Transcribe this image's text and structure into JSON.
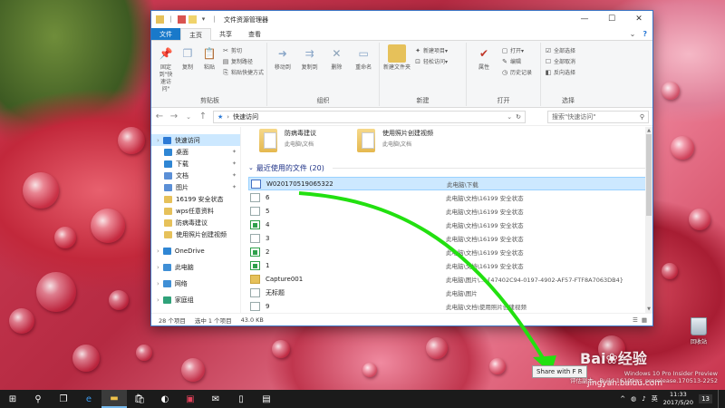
{
  "window": {
    "title": "文件资源管理器",
    "tabs": [
      "文件",
      "主页",
      "共享",
      "查看"
    ],
    "active_tab": "主页"
  },
  "ribbon": {
    "groups": [
      {
        "label": "剪贴板",
        "buttons": [
          "固定到\"快速访问\"",
          "复制",
          "粘贴"
        ],
        "small": [
          "剪切",
          "复制路径",
          "粘贴快捷方式"
        ]
      },
      {
        "label": "组织",
        "buttons": [
          "移动到",
          "复制到",
          "删除",
          "重命名"
        ]
      },
      {
        "label": "新建",
        "buttons": [
          "新建文件夹"
        ],
        "small": [
          "新建项目▾",
          "轻松访问▾"
        ]
      },
      {
        "label": "打开",
        "buttons": [
          "属性"
        ],
        "small": [
          "打开▾",
          "编辑",
          "历史记录"
        ]
      },
      {
        "label": "选择",
        "small": [
          "全部选择",
          "全部取消",
          "反向选择"
        ]
      }
    ]
  },
  "address": {
    "star": "★",
    "location": "快速访问",
    "search_placeholder": "搜索\"快速访问\""
  },
  "nav": {
    "items": [
      {
        "label": "快速访问",
        "top": true,
        "icon": "star-icon",
        "color": "#2c7ad6",
        "selected": true
      },
      {
        "label": "桌面",
        "icon": "desktop-icon",
        "color": "#2f86d4",
        "pinned": true
      },
      {
        "label": "下载",
        "icon": "download-icon",
        "color": "#2f86d4",
        "pinned": true
      },
      {
        "label": "文档",
        "icon": "document-icon",
        "color": "#5b8fd6",
        "pinned": true
      },
      {
        "label": "图片",
        "icon": "pictures-icon",
        "color": "#5b8fd6",
        "pinned": true
      },
      {
        "label": "16199 安全状态",
        "icon": "folder-icon",
        "color": "#e6c15a"
      },
      {
        "label": "wps任意资料",
        "icon": "folder-icon",
        "color": "#e6c15a"
      },
      {
        "label": "防病毒建议",
        "icon": "folder-icon",
        "color": "#e6c15a"
      },
      {
        "label": "使用照片创建视频",
        "icon": "folder-icon",
        "color": "#e6c15a"
      },
      {
        "label": "OneDrive",
        "top": true,
        "icon": "onedrive-icon",
        "color": "#2f86d4"
      },
      {
        "label": "此电脑",
        "top": true,
        "icon": "computer-icon",
        "color": "#3f8fd6"
      },
      {
        "label": "网络",
        "top": true,
        "icon": "network-icon",
        "color": "#3f8fd6"
      },
      {
        "label": "家庭组",
        "top": true,
        "icon": "homegroup-icon",
        "color": "#2fa27a"
      }
    ]
  },
  "tiles": [
    {
      "name": "防病毒建议",
      "path": "此电脑\\文档"
    },
    {
      "name": "使用照片创建视频",
      "path": "此电脑\\文档"
    }
  ],
  "section": {
    "label": "最近使用的文件 (20)"
  },
  "files": [
    {
      "name": "W020170519065322",
      "path": "此电脑\\下载",
      "icon": "doc",
      "selected": true
    },
    {
      "name": "6",
      "path": "此电脑\\文档\\16199 安全状态",
      "icon": "blank"
    },
    {
      "name": "5",
      "path": "此电脑\\文档\\16199 安全状态",
      "icon": "blank"
    },
    {
      "name": "4",
      "path": "此电脑\\文档\\16199 安全状态",
      "icon": "green"
    },
    {
      "name": "3",
      "path": "此电脑\\文档\\16199 安全状态",
      "icon": "blank"
    },
    {
      "name": "2",
      "path": "此电脑\\文档\\16199 安全状态",
      "icon": "green"
    },
    {
      "name": "1",
      "path": "此电脑\\文档\\16199 安全状态",
      "icon": "green"
    },
    {
      "name": "Capture001",
      "path": "此电脑\\图片\\...\\{47402C94-0197-4902-AF57-FTF8A7063DB4}",
      "icon": "folder"
    },
    {
      "name": "无标题",
      "path": "此电脑\\图片",
      "icon": "blank"
    },
    {
      "name": "9",
      "path": "此电脑\\文档\\使用照片创建视频",
      "icon": "blank"
    }
  ],
  "status": {
    "count": "28 个项目",
    "selected": "选中 1 个项目",
    "size": "43.0 KB"
  },
  "overlay": {
    "tooltip": "Share with F R",
    "recycle_bin": "回收站",
    "watermark": [
      "Windows 10 Pro Insider Preview",
      "评估副本。Build 16199.rs_prerelease.170513-2252"
    ],
    "baidu": "Bai❀经验",
    "baidu_site": "jingyan.baidu.com",
    "arrow_color": "#22e010"
  },
  "taskbar": {
    "time": "11:33",
    "date": "2017/5/20",
    "notifications": "13",
    "input_method": "英"
  }
}
